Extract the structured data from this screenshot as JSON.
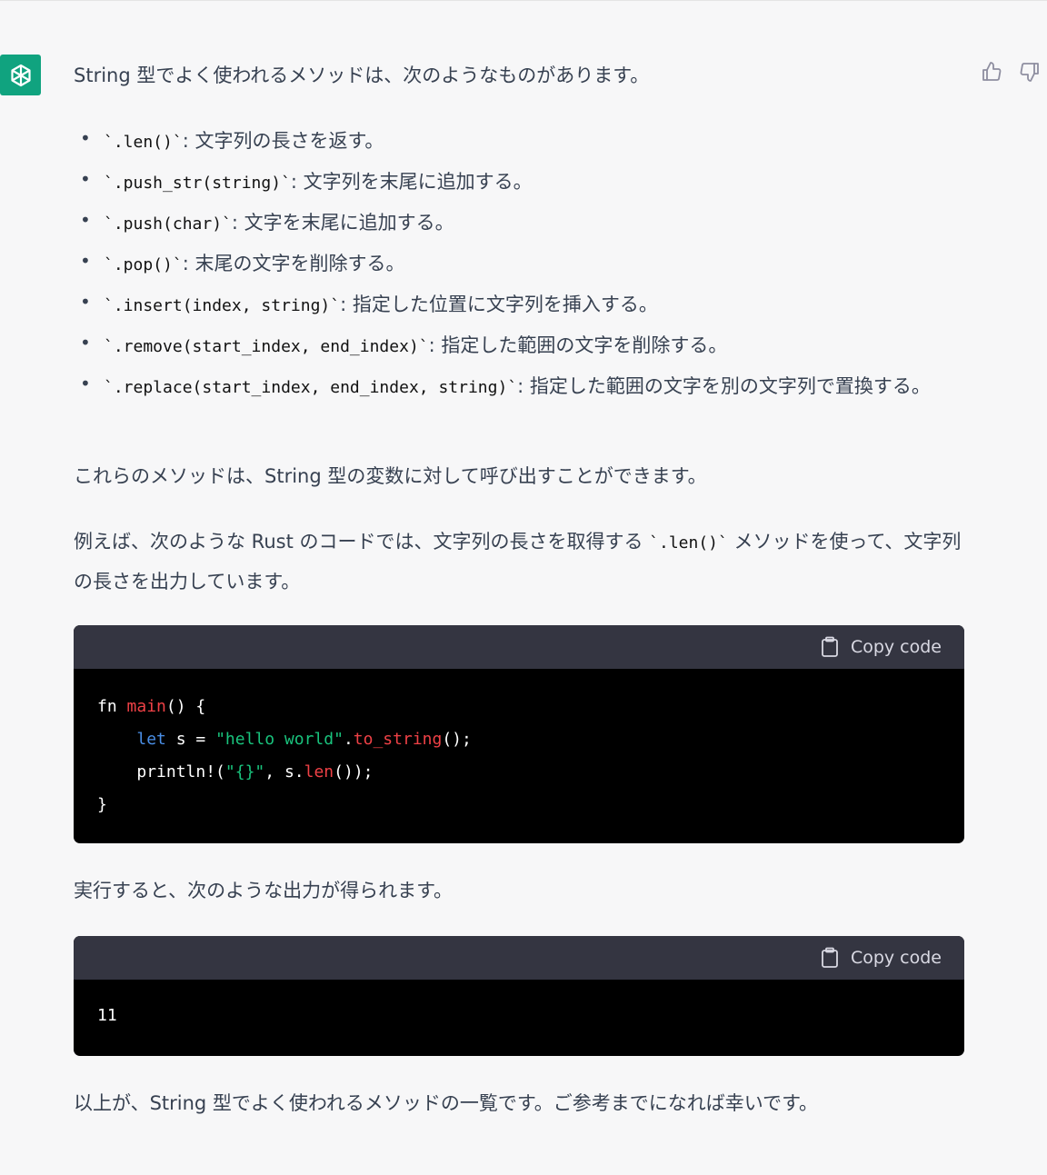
{
  "intro": "String 型でよく使われるメソッドは、次のようなものがあります。",
  "methods": [
    {
      "code": "`.len()`",
      "desc": ": 文字列の長さを返す。"
    },
    {
      "code": "`.push_str(string)`",
      "desc": ": 文字列を末尾に追加する。"
    },
    {
      "code": "`.push(char)`",
      "desc": ": 文字を末尾に追加する。"
    },
    {
      "code": "`.pop()`",
      "desc": ": 末尾の文字を削除する。"
    },
    {
      "code": "`.insert(index, string)`",
      "desc": ": 指定した位置に文字列を挿入する。"
    },
    {
      "code": "`.remove(start_index, end_index)`",
      "desc": ": 指定した範囲の文字を削除する。"
    },
    {
      "code": "`.replace(start_index, end_index, string)`",
      "desc": ": 指定した範囲の文字を別の文字列で置換する。"
    }
  ],
  "para2": "これらのメソッドは、String 型の変数に対して呼び出すことができます。",
  "para3_before": "例えば、次のような Rust のコードでは、文字列の長さを取得する ",
  "para3_code": "`.len()`",
  "para3_after": " メソッドを使って、文字列の長さを出力しています。",
  "code1": {
    "copy_label": "Copy code",
    "tokens": {
      "fn": "fn",
      "main": "main",
      "sig": "() {",
      "let": "let",
      "assign": " s = ",
      "str1": "\"hello world\"",
      "dot": ".",
      "to_string": "to_string",
      "end1": "();",
      "println": "println!(",
      "str2": "\"{}\"",
      "mid": ", s.",
      "len": "len",
      "end2": "());",
      "close": "}"
    }
  },
  "para4": "実行すると、次のような出力が得られます。",
  "code2": {
    "copy_label": "Copy code",
    "output": "11"
  },
  "para5": "以上が、String 型でよく使われるメソッドの一覧です。ご参考までになれば幸いです。",
  "colors": {
    "avatar_bg": "#10a37f",
    "code_header_bg": "#343541",
    "keyword": "#4a8fe7",
    "function": "#ef4146",
    "string": "#19c37d"
  },
  "icons": {
    "avatar": "openai-logo-icon",
    "thumbs_up": "thumbs-up-icon",
    "thumbs_down": "thumbs-down-icon",
    "copy": "clipboard-icon"
  }
}
